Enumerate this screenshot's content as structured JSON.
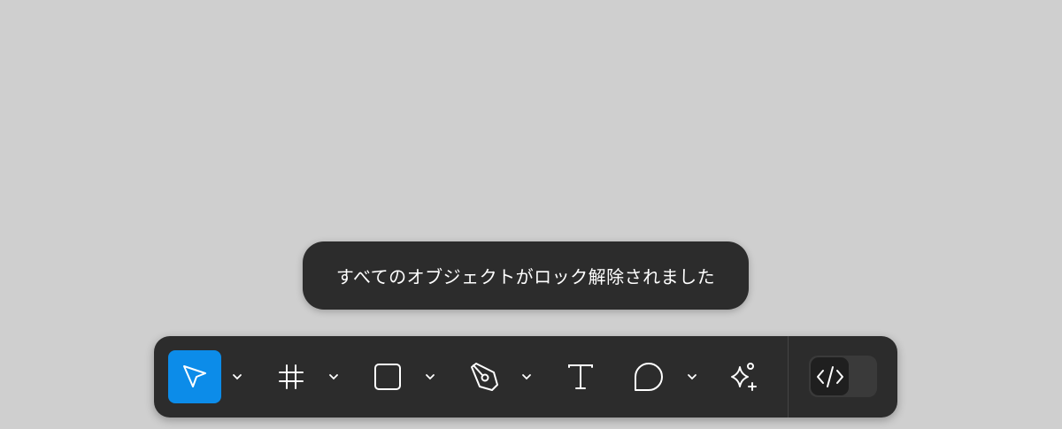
{
  "toast": {
    "message": "すべてのオブジェクトがロック解除されました"
  },
  "toolbar": {
    "tools": [
      {
        "name": "move",
        "icon": "cursor-arrow-icon",
        "active": true,
        "has_dropdown": true
      },
      {
        "name": "frame",
        "icon": "frame-hash-icon",
        "active": false,
        "has_dropdown": true
      },
      {
        "name": "shape",
        "icon": "rectangle-icon",
        "active": false,
        "has_dropdown": true
      },
      {
        "name": "pen",
        "icon": "pen-icon",
        "active": false,
        "has_dropdown": true
      },
      {
        "name": "text",
        "icon": "text-t-icon",
        "active": false,
        "has_dropdown": false
      },
      {
        "name": "comment",
        "icon": "comment-bubble-icon",
        "active": false,
        "has_dropdown": true
      },
      {
        "name": "actions",
        "icon": "sparkle-plus-icon",
        "active": false,
        "has_dropdown": false
      }
    ],
    "dev_mode": {
      "icon": "code-brackets-icon",
      "enabled": false
    }
  },
  "colors": {
    "canvas": "#cfcfcf",
    "toolbar_bg": "#2c2c2c",
    "active_accent": "#0c8ce9",
    "icon": "#ffffff"
  }
}
